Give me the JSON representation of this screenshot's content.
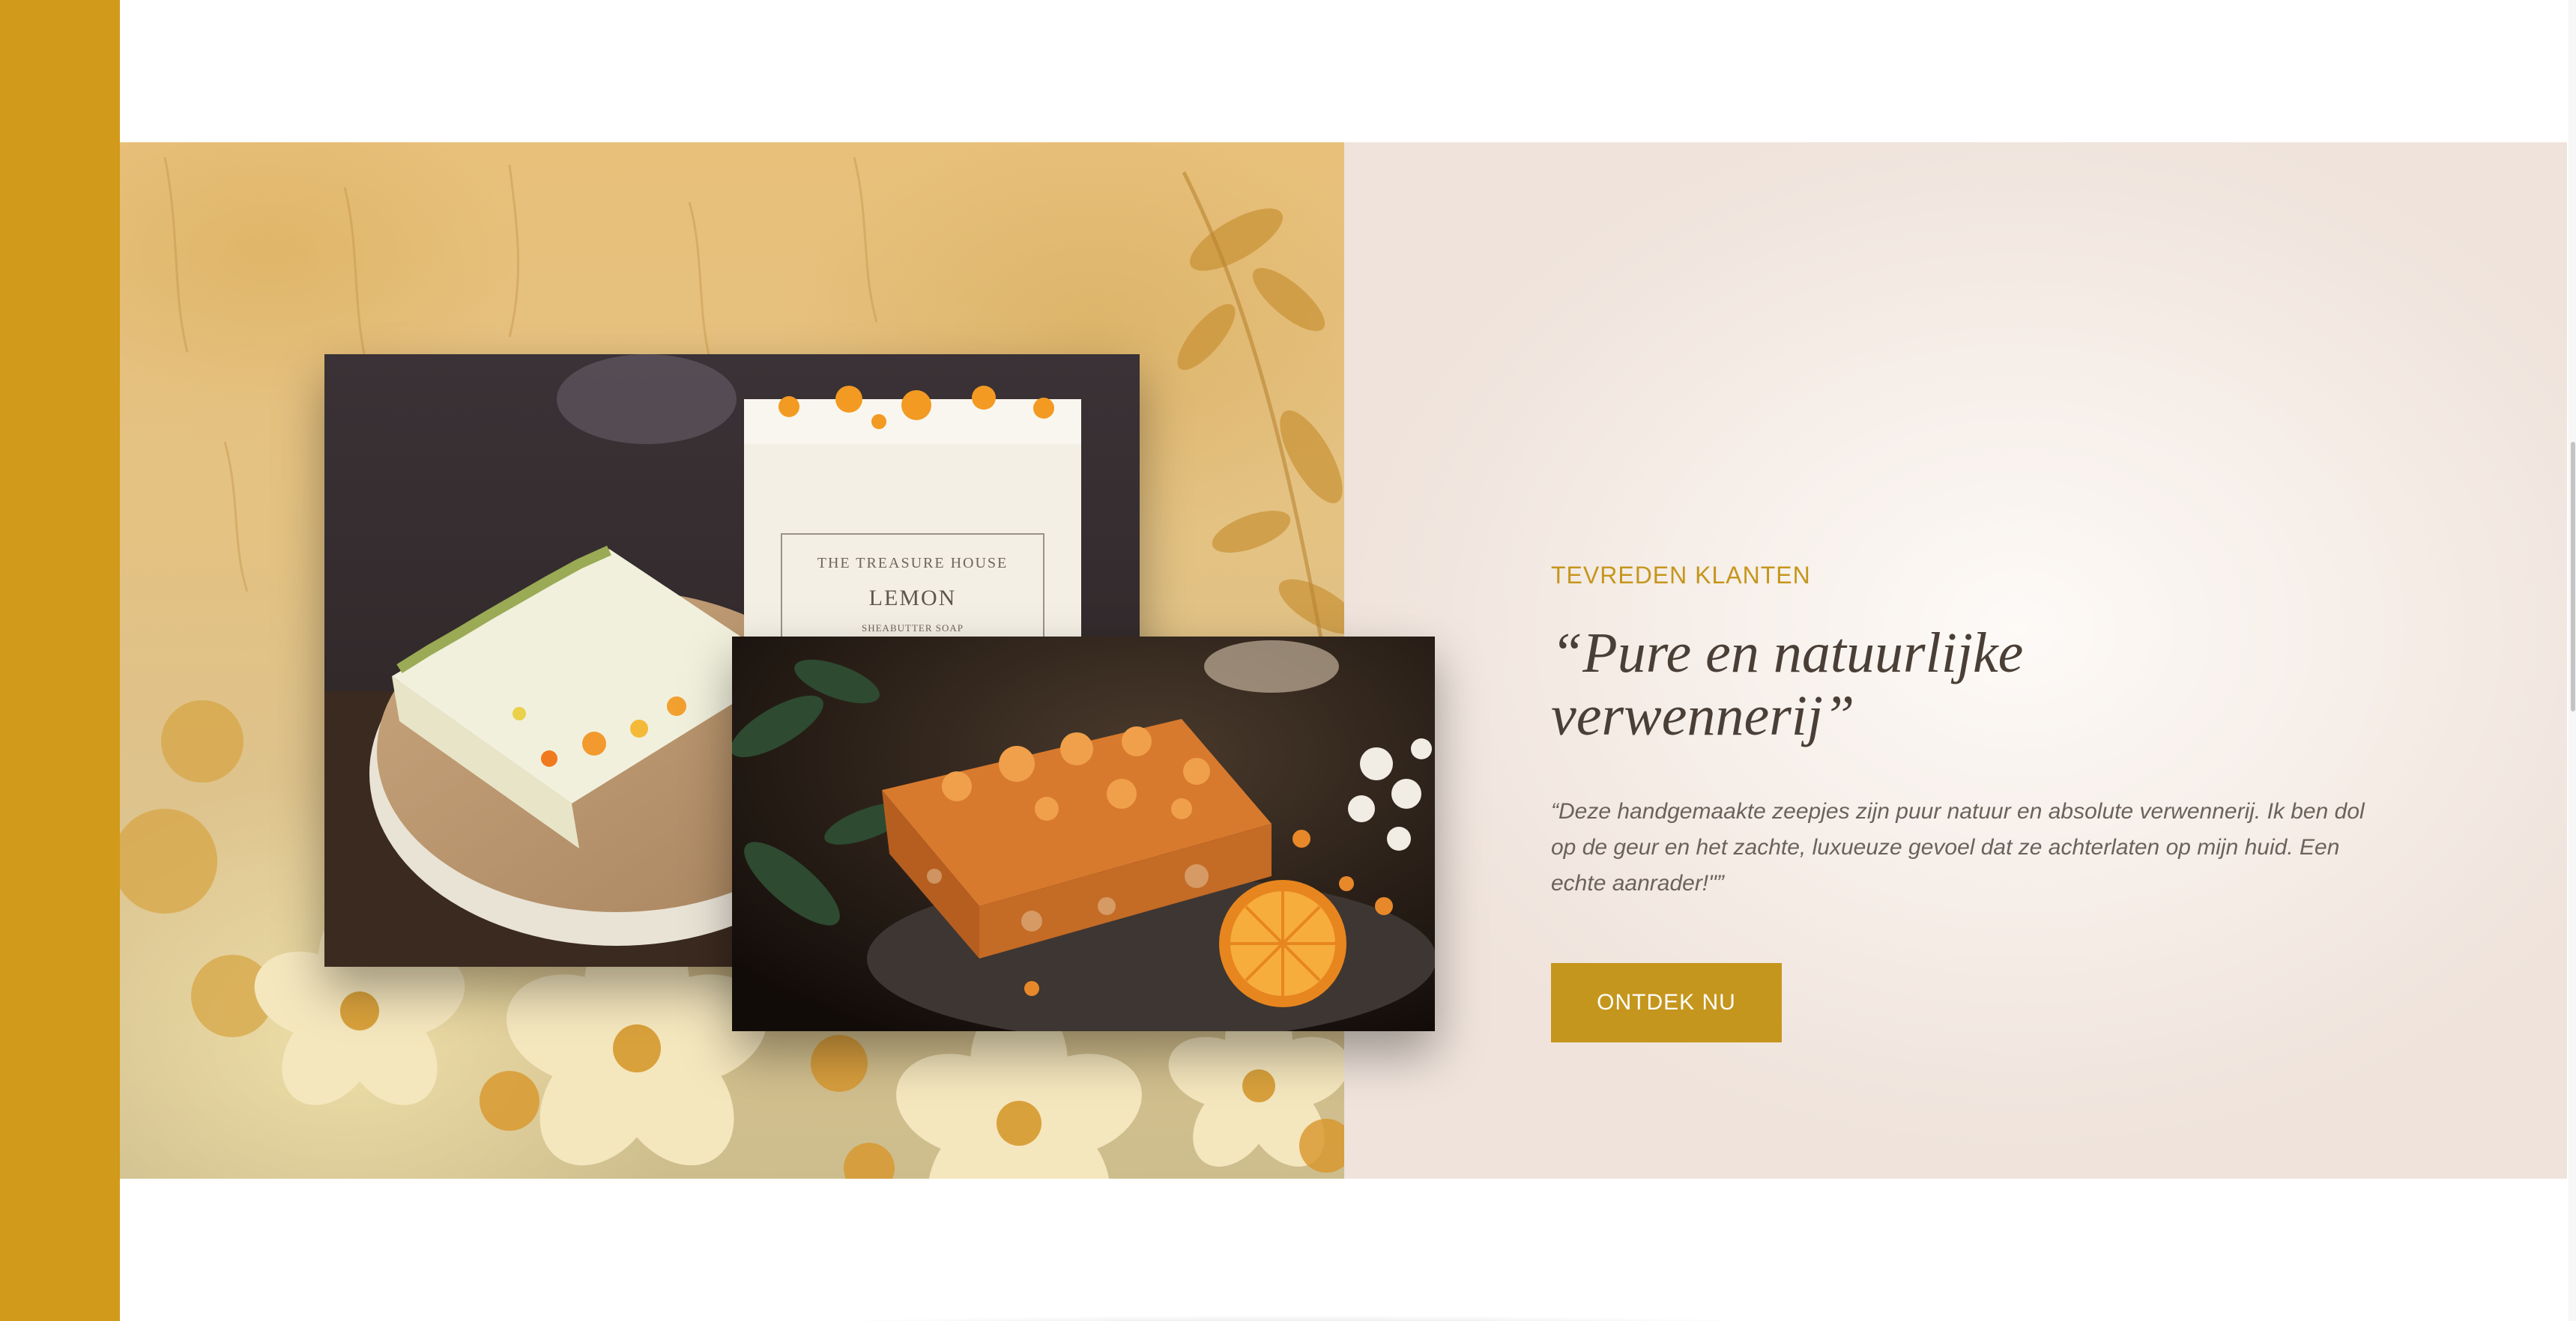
{
  "testimonial": {
    "eyebrow": "TEVREDEN KLANTEN",
    "title": "“Pure en natuurlijke verwennerij”",
    "body": "“Deze handgemaakte zeepjes zijn puur natuur en absolute verwennerij. Ik ben dol op de geur en het zachte, luxueuze gevoel dat ze achterlaten op mijn huid. Een echte aanrader!\"”",
    "cta_label": "ONTDEK NU"
  },
  "soap_label": {
    "brand": "THE TREASURE HOUSE",
    "name": "LEMON",
    "type": "SHEABUTTER SOAP"
  },
  "colors": {
    "accent": "#c5961d",
    "rail": "#d19a1b",
    "title_text": "#4a3f37",
    "body_text": "#6b625b"
  }
}
